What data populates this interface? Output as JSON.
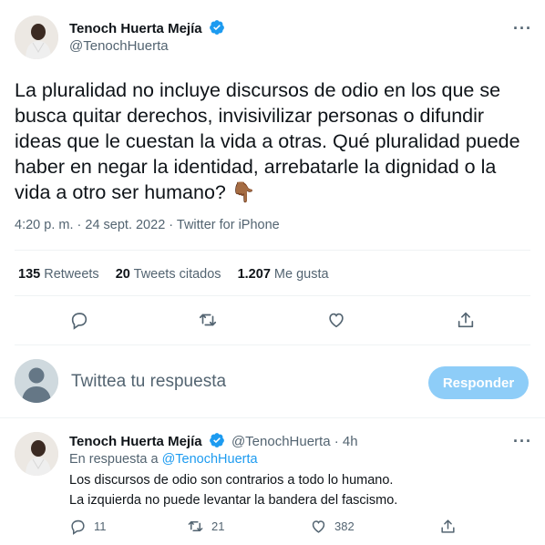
{
  "tweet": {
    "author_name": "Tenoch Huerta Mejía",
    "author_handle": "@TenochHuerta",
    "more_label": "···",
    "text": "La pluralidad no incluye discursos de odio en los que se busca quitar derechos, invisivilizar personas o difundir ideas que le cuestan la vida a otras. Qué pluralidad puede haber en negar la identidad, arrebatarle la dignidad o la vida a otro ser humano?",
    "emoji": "👇🏾",
    "time": "4:20 p. m.",
    "date": "24 sept. 2022",
    "source": "Twitter for iPhone",
    "separator": " · ",
    "stats": {
      "retweets_count": "135",
      "retweets_label": "Retweets",
      "quotes_count": "20",
      "quotes_label": "Tweets citados",
      "likes_count": "1.207",
      "likes_label": "Me gusta"
    }
  },
  "composer": {
    "placeholder": "Twittea tu respuesta",
    "button_label": "Responder"
  },
  "reply": {
    "author_name": "Tenoch Huerta Mejía",
    "author_handle": "@TenochHuerta",
    "age": "4h",
    "separator": " · ",
    "replying_prefix": "En respuesta a",
    "replying_to": "@TenochHuerta",
    "line1": "Los discursos de odio son contrarios a todo lo humano.",
    "line2": "La izquierda no puede levantar la bandera del fascismo.",
    "more_label": "···",
    "actions": {
      "replies": "11",
      "retweets": "21",
      "likes": "382"
    }
  },
  "colors": {
    "accent": "#1d9bf0",
    "button_disabled": "#8ecdf8",
    "secondary_text": "#536471"
  }
}
